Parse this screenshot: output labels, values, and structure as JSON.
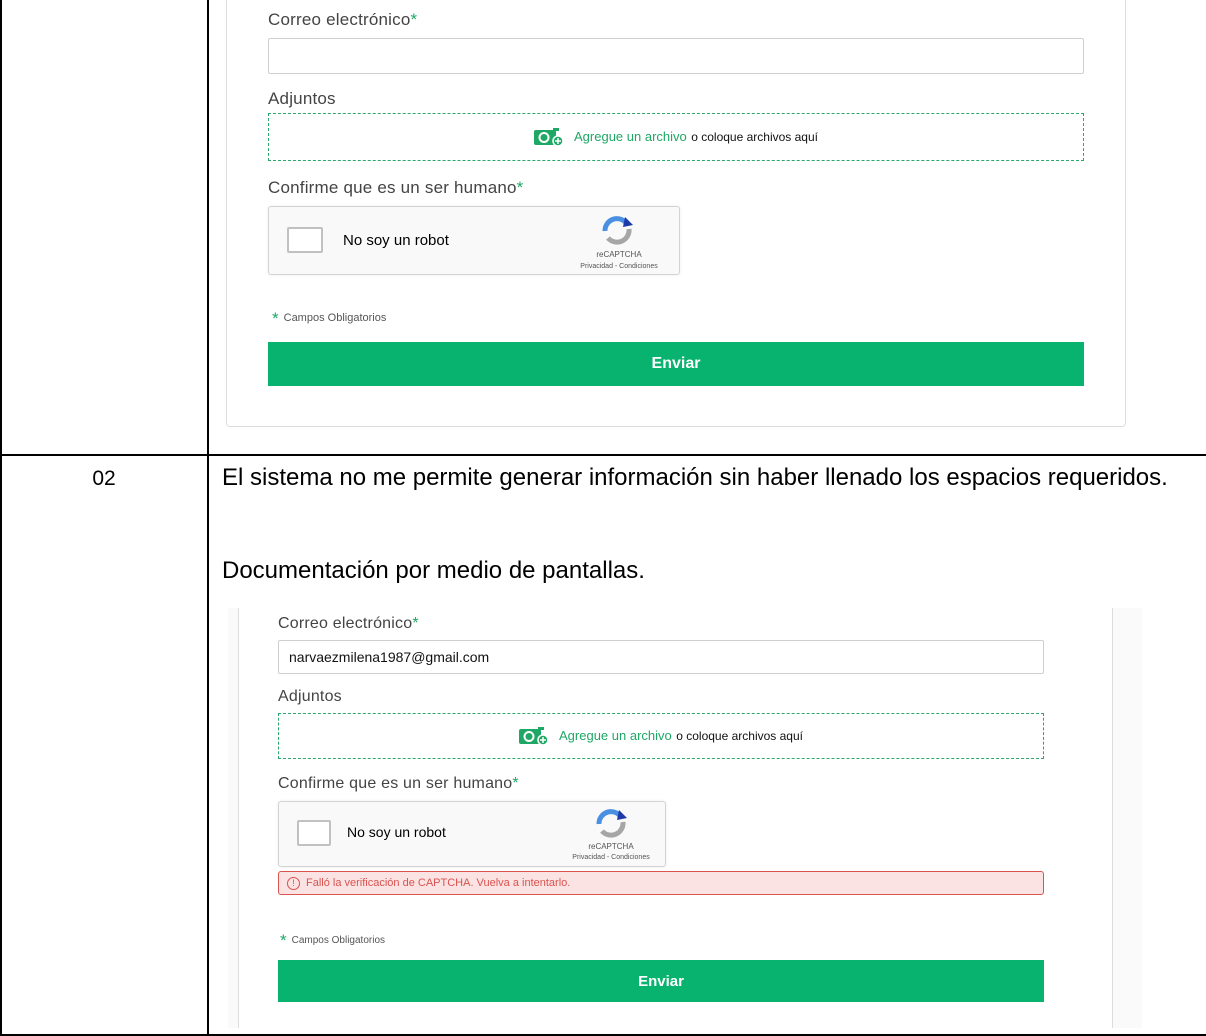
{
  "screen1": {
    "email_label": "Correo electrónico",
    "required_mark": "*",
    "email_value": "",
    "attachments_label": "Adjuntos",
    "attach_link": "Agregue un archivo",
    "attach_text": "o coloque archivos aquí",
    "human_label": "Confirme que es un ser humano",
    "captcha_label": "No soy un robot",
    "captcha_brand": "reCAPTCHA",
    "captcha_terms": "Privacidad - Condiciones",
    "required_note_star": "*",
    "required_note": "Campos Obligatorios",
    "submit_label": "Enviar"
  },
  "row2": {
    "number": "02",
    "description": "El sistema no me permite generar información sin haber llenado los espacios requeridos.",
    "documentation": "Documentación  por medio de pantallas."
  },
  "screen2": {
    "email_label": "Correo electrónico",
    "required_mark": "*",
    "email_value": "narvaezmilena1987@gmail.com",
    "attachments_label": "Adjuntos",
    "attach_link": "Agregue un archivo",
    "attach_text": "o coloque archivos aquí",
    "human_label": "Confirme que es un ser humano",
    "captcha_label": "No soy un robot",
    "captcha_brand": "reCAPTCHA",
    "captcha_terms": "Privacidad - Condiciones",
    "error_message": "Falló la verificación de CAPTCHA. Vuelva a intentarlo.",
    "error_icon": "!",
    "required_note_star": "*",
    "required_note": "Campos Obligatorios",
    "submit_label": "Enviar"
  },
  "colors": {
    "accent_green": "#07b36e",
    "required_green": "#1fa865",
    "error_red": "#d9534f"
  },
  "icons": [
    "attach-file-icon",
    "recaptcha-logo-icon",
    "error-circle-icon"
  ]
}
